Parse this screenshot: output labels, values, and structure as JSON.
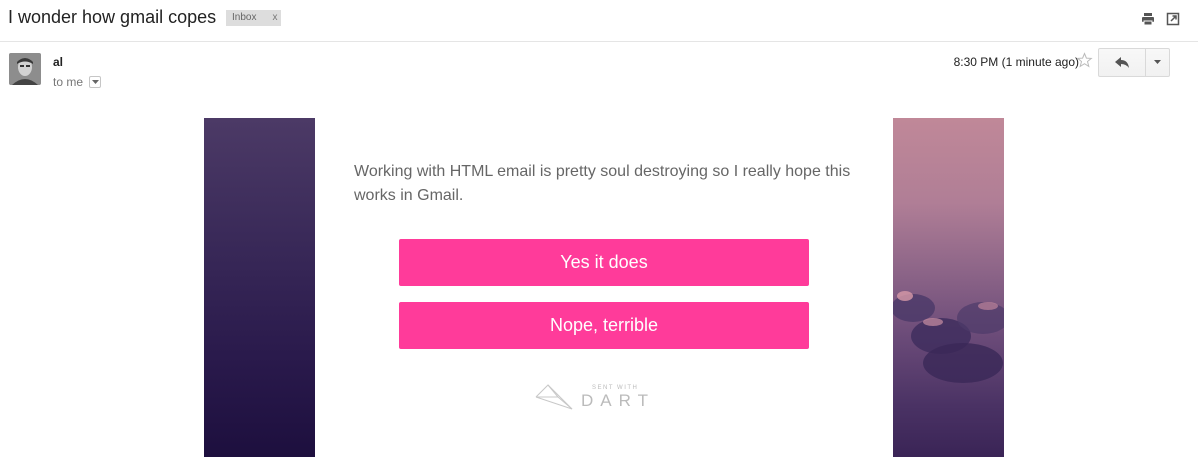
{
  "subject": "I wonder how gmail copes",
  "label": {
    "name": "Inbox",
    "remove": "x"
  },
  "sender": {
    "name": "al",
    "to": "to me"
  },
  "timestamp": "8:30 PM (1 minute ago)",
  "toolbar": {
    "icons": [
      "print-icon",
      "new-window-icon",
      "star-icon",
      "reply-icon",
      "chevron-down-icon"
    ]
  },
  "email": {
    "message": "Working with HTML email is pretty soul destroying so I really hope this works in Gmail.",
    "buttons": [
      "Yes it does",
      "Nope, terrible"
    ],
    "footer": {
      "sent_with": "SENT WITH",
      "brand": "DART"
    }
  },
  "colors": {
    "accent": "#ff3b9a",
    "text_muted": "#666666"
  }
}
